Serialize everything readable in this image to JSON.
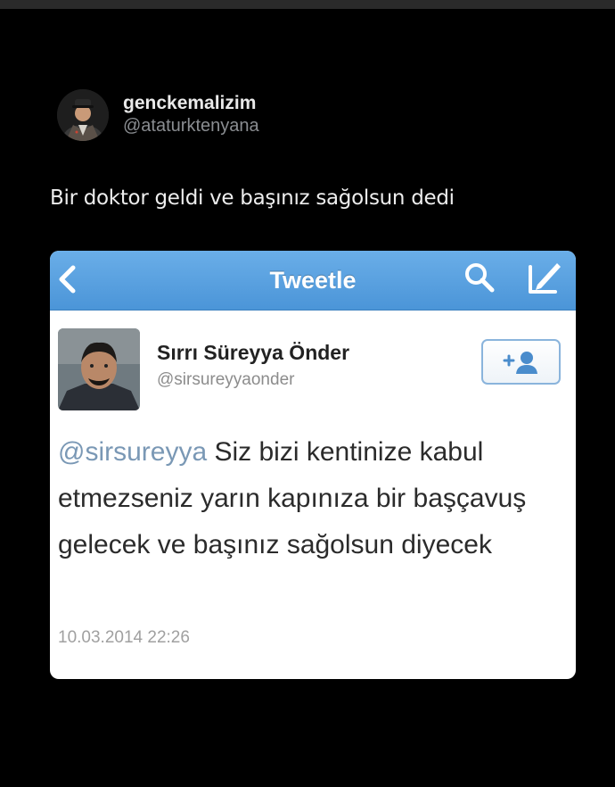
{
  "post": {
    "author": {
      "display_name": "genckemalizim",
      "handle": "@ataturktenyana",
      "avatar_icon": "avatar-portrait-icon"
    },
    "text": "Bir doktor geldi ve başınız sağolsun dedi"
  },
  "embedded_screenshot": {
    "nav": {
      "title": "Tweetle",
      "back_icon": "chevron-left-icon",
      "search_icon": "search-icon",
      "compose_icon": "compose-icon",
      "bar_color": "#5ba2e0"
    },
    "tweet": {
      "display_name": "Sırrı Süreyya Önder",
      "handle": "@sirsureyyaonder",
      "follow_icon": "add-user-icon",
      "mention": "@sirsureyya",
      "body": " Siz bizi kentinize kabul etmezseniz yarın kapınıza bir başçavuş gelecek ve başınız sağolsun diyecek",
      "timestamp": "10.03.2014 22:26",
      "mention_color": "#7a98b5"
    }
  }
}
